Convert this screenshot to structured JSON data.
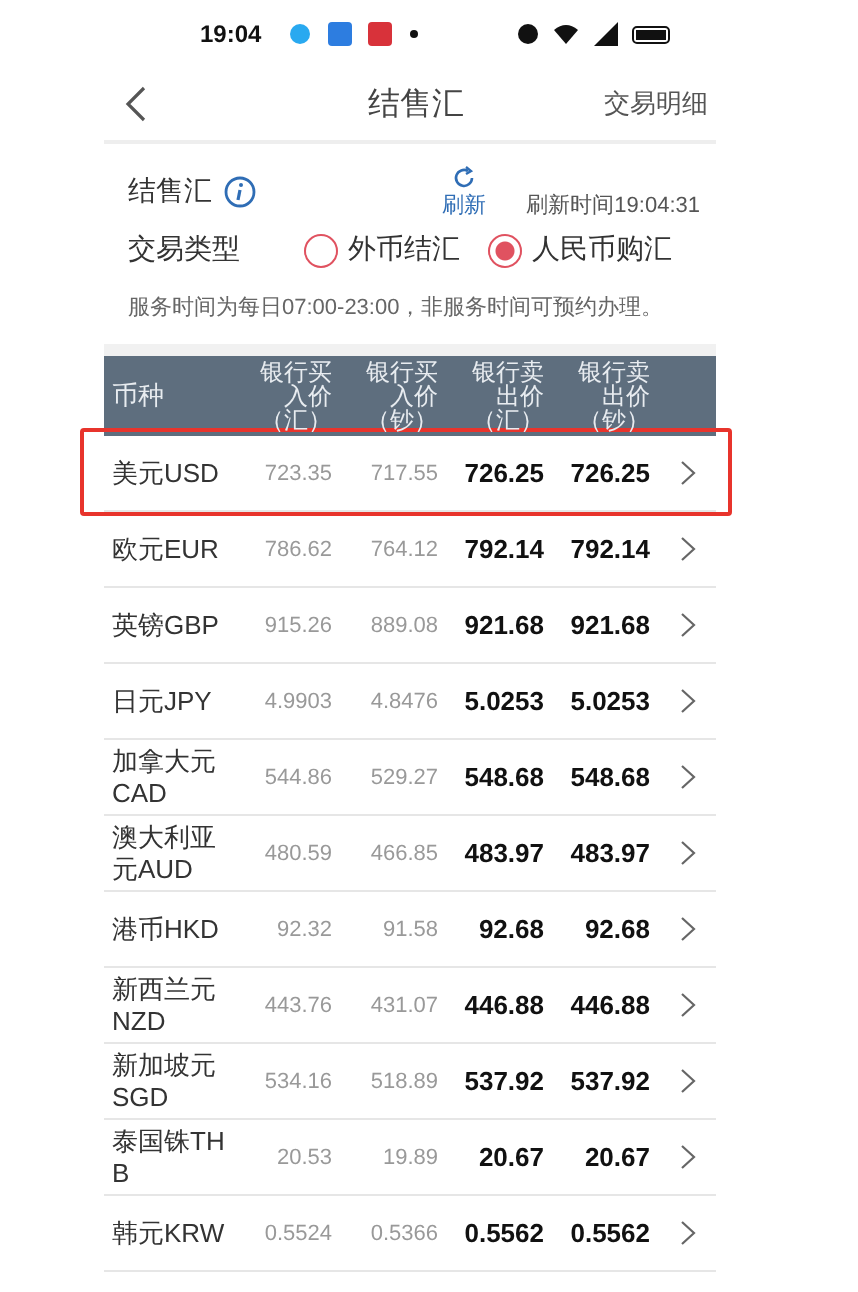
{
  "status_bar": {
    "time": "19:04"
  },
  "nav": {
    "title": "结售汇",
    "action": "交易明细"
  },
  "info": {
    "label": "结售汇",
    "refresh": "刷新",
    "refresh_time": "刷新时间19:04:31"
  },
  "trade_type": {
    "label": "交易类型",
    "options": [
      {
        "label": "外币结汇",
        "selected": false
      },
      {
        "label": "人民币购汇",
        "selected": true
      }
    ]
  },
  "notice": "服务时间为每日07:00-23:00，非服务时间可预约办理。",
  "table": {
    "columns": [
      "币种",
      "银行买入价（汇）",
      "银行买入价（钞）",
      "银行卖出价（汇）",
      "银行卖出价（钞）"
    ],
    "rows": [
      {
        "cells": [
          "美元USD",
          "723.35",
          "717.55",
          "726.25",
          "726.25"
        ],
        "highlighted": true
      },
      {
        "cells": [
          "欧元EUR",
          "786.62",
          "764.12",
          "792.14",
          "792.14"
        ],
        "highlighted": false
      },
      {
        "cells": [
          "英镑GBP",
          "915.26",
          "889.08",
          "921.68",
          "921.68"
        ],
        "highlighted": false
      },
      {
        "cells": [
          "日元JPY",
          "4.9903",
          "4.8476",
          "5.0253",
          "5.0253"
        ],
        "highlighted": false
      },
      {
        "cells": [
          "加拿大元CAD",
          "544.86",
          "529.27",
          "548.68",
          "548.68"
        ],
        "highlighted": false
      },
      {
        "cells": [
          "澳大利亚元AUD",
          "480.59",
          "466.85",
          "483.97",
          "483.97"
        ],
        "highlighted": false
      },
      {
        "cells": [
          "港币HKD",
          "92.32",
          "91.58",
          "92.68",
          "92.68"
        ],
        "highlighted": false
      },
      {
        "cells": [
          "新西兰元NZD",
          "443.76",
          "431.07",
          "446.88",
          "446.88"
        ],
        "highlighted": false
      },
      {
        "cells": [
          "新加坡元SGD",
          "534.16",
          "518.89",
          "537.92",
          "537.92"
        ],
        "highlighted": false
      },
      {
        "cells": [
          "泰国铢THB",
          "20.53",
          "19.89",
          "20.67",
          "20.67"
        ],
        "highlighted": false
      },
      {
        "cells": [
          "韩元KRW",
          "0.5524",
          "0.5366",
          "0.5562",
          "0.5562"
        ],
        "highlighted": false
      }
    ]
  }
}
